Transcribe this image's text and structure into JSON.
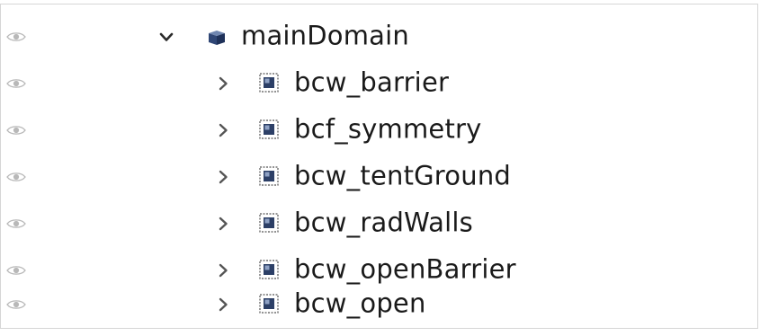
{
  "tree": {
    "root": {
      "label": "mainDomain",
      "expanded": true,
      "icon": "domain-cube-icon",
      "visibility_icon": "eye-icon"
    },
    "children": [
      {
        "label": "bcw_barrier",
        "icon": "boundary-cube-icon",
        "expanded": false
      },
      {
        "label": "bcf_symmetry",
        "icon": "boundary-cube-icon",
        "expanded": false
      },
      {
        "label": "bcw_tentGround",
        "icon": "boundary-cube-icon",
        "expanded": false
      },
      {
        "label": "bcw_radWalls",
        "icon": "boundary-cube-icon",
        "expanded": false
      },
      {
        "label": "bcw_openBarrier",
        "icon": "boundary-cube-icon",
        "expanded": false
      },
      {
        "label": "bcw_open",
        "icon": "boundary-cube-icon",
        "expanded": false
      }
    ]
  },
  "colors": {
    "eye": "#b8b8b8",
    "chevron": "#4a4a4a",
    "cube_dark": "#26385f",
    "cube_light": "#7f93b8",
    "text": "#1a1a1a"
  }
}
